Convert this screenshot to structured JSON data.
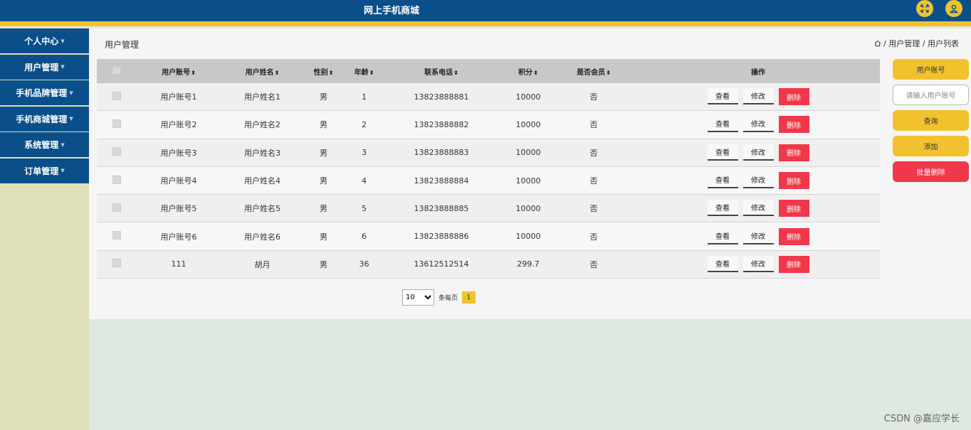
{
  "header": {
    "title": "网上手机商城",
    "fullscreen_icon": "expand-arrows-icon",
    "user_icon": "user-icon"
  },
  "sidebar": {
    "items": [
      {
        "label": "个人中心"
      },
      {
        "label": "用户管理"
      },
      {
        "label": "手机品牌管理"
      },
      {
        "label": "手机商城管理"
      },
      {
        "label": "系统管理"
      },
      {
        "label": "订单管理"
      }
    ]
  },
  "main": {
    "title": "用户管理",
    "breadcrumb": {
      "home_icon": "home-icon",
      "text": "/ 用户管理 / 用户列表"
    }
  },
  "table": {
    "columns": {
      "account": "用户账号",
      "name": "用户姓名",
      "gender": "性别",
      "age": "年龄",
      "phone": "联系电话",
      "points": "积分",
      "vip": "是否会员",
      "ops": "操作"
    },
    "view_label": "查看",
    "edit_label": "修改",
    "delete_label": "删除",
    "rows": [
      {
        "account": "用户账号1",
        "name": "用户姓名1",
        "gender": "男",
        "age": "1",
        "phone": "13823888881",
        "points": "10000",
        "vip": "否"
      },
      {
        "account": "用户账号2",
        "name": "用户姓名2",
        "gender": "男",
        "age": "2",
        "phone": "13823888882",
        "points": "10000",
        "vip": "否"
      },
      {
        "account": "用户账号3",
        "name": "用户姓名3",
        "gender": "男",
        "age": "3",
        "phone": "13823888883",
        "points": "10000",
        "vip": "否"
      },
      {
        "account": "用户账号4",
        "name": "用户姓名4",
        "gender": "男",
        "age": "4",
        "phone": "13823888884",
        "points": "10000",
        "vip": "否"
      },
      {
        "account": "用户账号5",
        "name": "用户姓名5",
        "gender": "男",
        "age": "5",
        "phone": "13823888885",
        "points": "10000",
        "vip": "否"
      },
      {
        "account": "用户账号6",
        "name": "用户姓名6",
        "gender": "男",
        "age": "6",
        "phone": "13823888886",
        "points": "10000",
        "vip": "否"
      },
      {
        "account": "111",
        "name": "胡月",
        "gender": "男",
        "age": "36",
        "phone": "13612512514",
        "points": "299.7",
        "vip": "否"
      }
    ]
  },
  "pagination": {
    "page_size": "10",
    "per_page_label": "条每页",
    "current_page": "1"
  },
  "search": {
    "label": "用户账号",
    "placeholder": "请输入用户账号",
    "query_label": "查询",
    "add_label": "添加",
    "batch_delete_label": "批量删除"
  },
  "watermark": "CSDN @嘉应学长",
  "colors": {
    "primary": "#0b4f8a",
    "accent": "#f2c12e",
    "danger": "#f0384a"
  }
}
